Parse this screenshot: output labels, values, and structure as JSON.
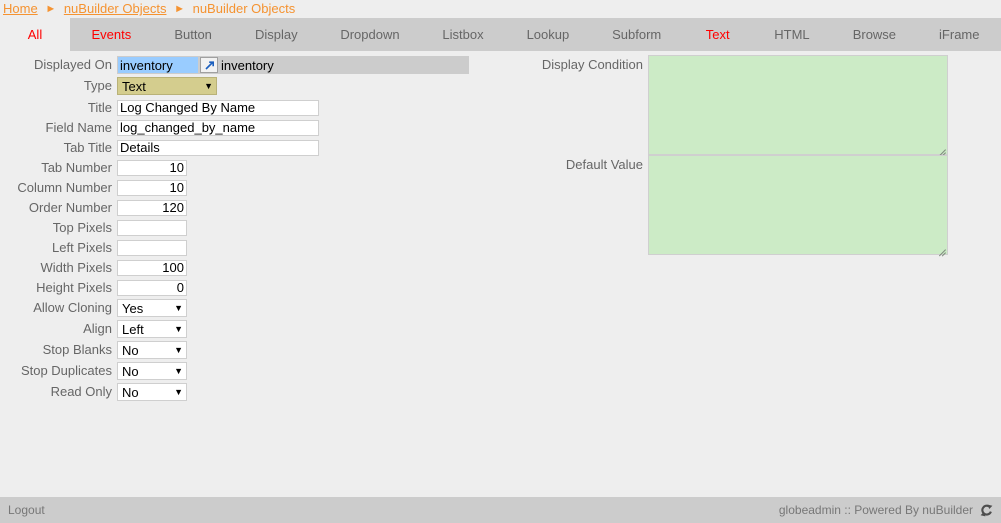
{
  "breadcrumb": {
    "items": [
      {
        "label": "Home",
        "link": true
      },
      {
        "label": "nuBuilder Objects",
        "link": true
      },
      {
        "label": "nuBuilder Objects",
        "link": false
      }
    ],
    "separator": "►"
  },
  "tabs": [
    {
      "label": "All",
      "state": "active"
    },
    {
      "label": "Events",
      "state": "red"
    },
    {
      "label": "Button",
      "state": "normal"
    },
    {
      "label": "Display",
      "state": "normal"
    },
    {
      "label": "Dropdown",
      "state": "normal"
    },
    {
      "label": "Listbox",
      "state": "normal"
    },
    {
      "label": "Lookup",
      "state": "normal"
    },
    {
      "label": "Subform",
      "state": "normal"
    },
    {
      "label": "Text",
      "state": "red"
    },
    {
      "label": "HTML",
      "state": "normal"
    },
    {
      "label": "Browse",
      "state": "normal"
    },
    {
      "label": "iFrame",
      "state": "normal"
    }
  ],
  "form": {
    "displayed_on": {
      "label": "Displayed On",
      "code_value": "inventory",
      "description": "inventory",
      "button_icon": "lookup-arrow-icon"
    },
    "type": {
      "label": "Type",
      "value": "Text",
      "arrow": "▼"
    },
    "title": {
      "label": "Title",
      "value": "Log Changed By Name"
    },
    "field_name": {
      "label": "Field Name",
      "value": "log_changed_by_name"
    },
    "tab_title": {
      "label": "Tab Title",
      "value": "Details"
    },
    "tab_number": {
      "label": "Tab Number",
      "value": "10"
    },
    "column_number": {
      "label": "Column Number",
      "value": "10"
    },
    "order_number": {
      "label": "Order Number",
      "value": "120"
    },
    "top_pixels": {
      "label": "Top Pixels",
      "value": ""
    },
    "left_pixels": {
      "label": "Left Pixels",
      "value": ""
    },
    "width_pixels": {
      "label": "Width Pixels",
      "value": "100"
    },
    "height_pixels": {
      "label": "Height Pixels",
      "value": "0"
    },
    "allow_cloning": {
      "label": "Allow Cloning",
      "value": "Yes",
      "arrow": "▼"
    },
    "align": {
      "label": "Align",
      "value": "Left",
      "arrow": "▼"
    },
    "stop_blanks": {
      "label": "Stop Blanks",
      "value": "No",
      "arrow": "▼"
    },
    "stop_duplicates": {
      "label": "Stop Duplicates",
      "value": "No",
      "arrow": "▼"
    },
    "read_only": {
      "label": "Read Only",
      "value": "No",
      "arrow": "▼"
    },
    "display_condition": {
      "label": "Display Condition",
      "value": ""
    },
    "default_value": {
      "label": "Default Value",
      "value": ""
    }
  },
  "footer": {
    "logout": "Logout",
    "status": "globeadmin :: Powered By nuBuilder",
    "refresh_icon": "refresh-icon"
  },
  "colors": {
    "breadcrumb_link": "#f59331",
    "tab_red": "#ff0000",
    "tabbar_bg": "#cccccc",
    "body_bg": "#eeeeee",
    "textarea_green": "#ccebc6",
    "type_select_bg": "#d4cd8e",
    "lookup_highlight": "#99ccff",
    "footer_bg": "#cccccc"
  }
}
